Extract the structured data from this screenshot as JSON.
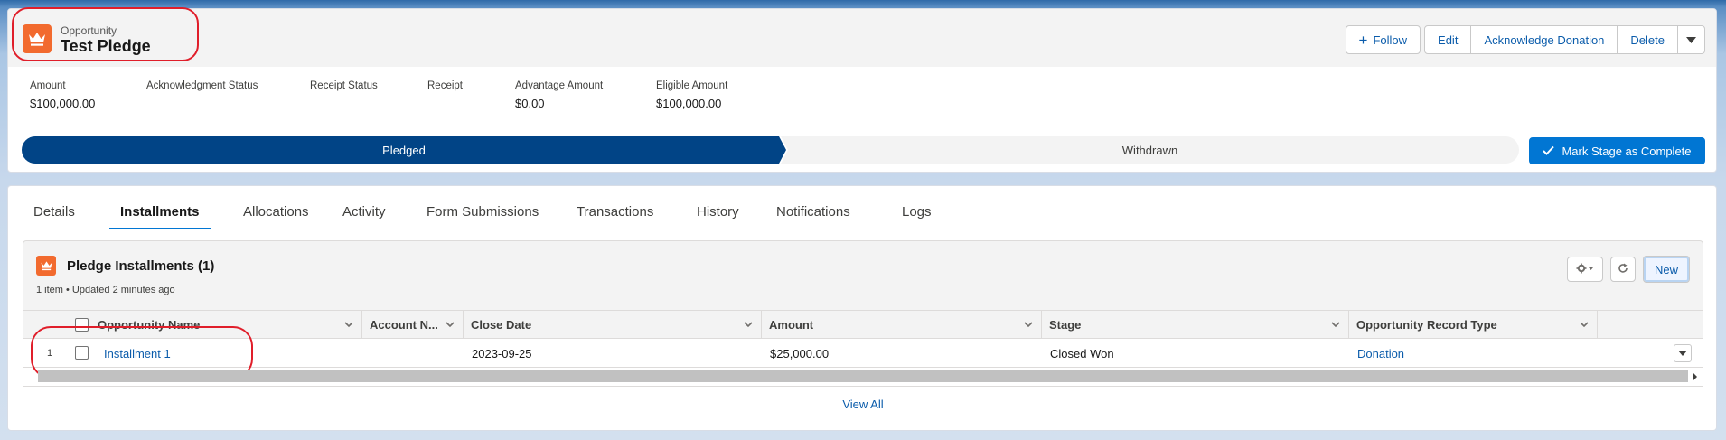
{
  "header": {
    "object_type": "Opportunity",
    "record_title": "Test Pledge",
    "object_icon": "crown-icon",
    "buttons": {
      "follow": "Follow",
      "edit": "Edit",
      "acknowledge": "Acknowledge Donation",
      "delete": "Delete"
    }
  },
  "highlights": [
    {
      "label": "Amount",
      "value": "$100,000.00"
    },
    {
      "label": "Acknowledgment Status",
      "value": ""
    },
    {
      "label": "Receipt Status",
      "value": ""
    },
    {
      "label": "Receipt",
      "value": ""
    },
    {
      "label": "Advantage Amount",
      "value": "$0.00"
    },
    {
      "label": "Eligible Amount",
      "value": "$100,000.00"
    }
  ],
  "path": {
    "stages": [
      "Pledged",
      "Withdrawn"
    ],
    "current_stage": "Pledged",
    "mark_complete_label": "Mark Stage as Complete"
  },
  "tabs": [
    "Details",
    "Installments",
    "Allocations",
    "Activity",
    "Form Submissions",
    "Transactions",
    "History",
    "Notifications",
    "Logs"
  ],
  "active_tab": "Installments",
  "related_list": {
    "title": "Pledge Installments (1)",
    "subtitle": "1 item • Updated 2 minutes ago",
    "new_label": "New",
    "columns": [
      "Opportunity Name",
      "Account N...",
      "Close Date",
      "Amount",
      "Stage",
      "Opportunity Record Type"
    ],
    "rows": [
      {
        "index": "1",
        "opportunity_name": "Installment 1",
        "account_name": "",
        "close_date": "2023-09-25",
        "amount": "$25,000.00",
        "stage": "Closed Won",
        "record_type": "Donation"
      }
    ],
    "view_all_label": "View All"
  },
  "colors": {
    "accent": "#0176d3",
    "path_active": "#014486",
    "object_icon": "#f26a2e",
    "annotation": "#e01e2a"
  }
}
